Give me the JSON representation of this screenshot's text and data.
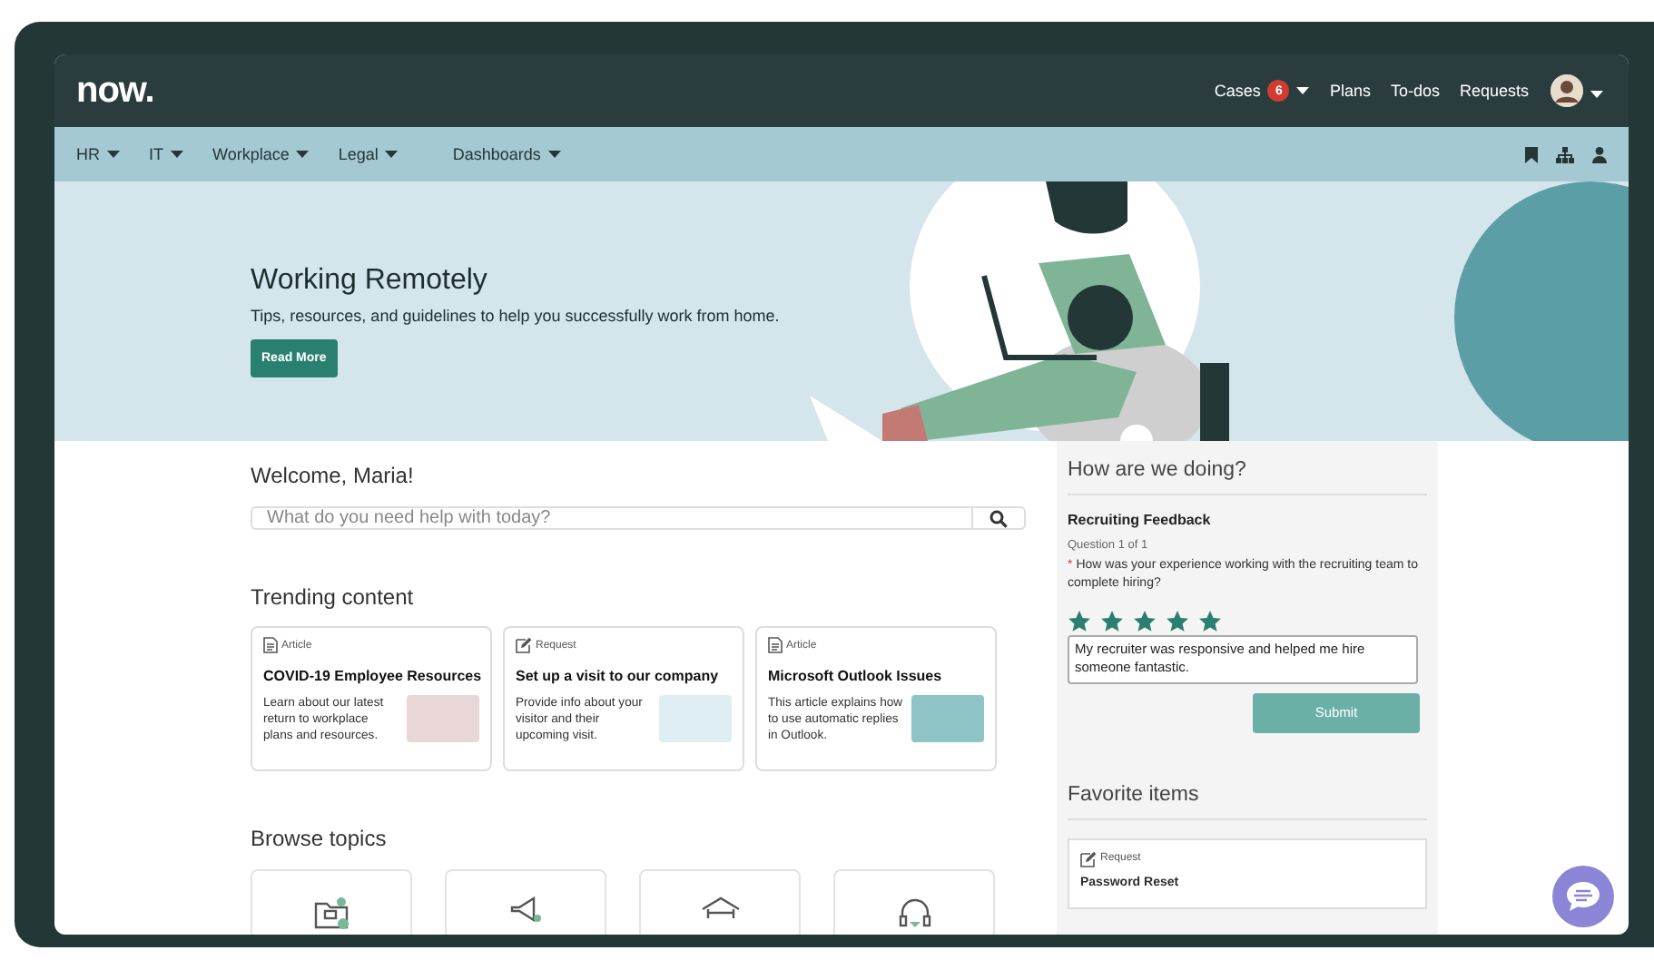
{
  "header": {
    "logo": "now.",
    "links": [
      {
        "label": "Cases",
        "badge": "6",
        "dropdown": true
      },
      {
        "label": "Plans",
        "dropdown": false
      },
      {
        "label": "To-dos",
        "dropdown": false
      },
      {
        "label": "Requests",
        "dropdown": false
      }
    ]
  },
  "nav": {
    "items": [
      "HR",
      "IT",
      "Workplace",
      "Legal",
      "Dashboards"
    ]
  },
  "hero": {
    "title": "Working Remotely",
    "subtitle": "Tips, resources, and guidelines to help you successfully work from home.",
    "button": "Read More"
  },
  "welcome": "Welcome, Maria!",
  "search": {
    "placeholder": "What do you need help with today?"
  },
  "trending": {
    "title": "Trending content",
    "cards": [
      {
        "kind": "article",
        "type_label": "Article",
        "title": "COVID-19 Employee Resources",
        "description": "Learn about our latest return to workplace plans and resources."
      },
      {
        "kind": "request",
        "type_label": "Request",
        "title": "Set up a visit to our company",
        "description": "Provide info about your visitor and their upcoming visit."
      },
      {
        "kind": "article",
        "type_label": "Article",
        "title": "Microsoft Outlook Issues",
        "description": "This article explains how to use automatic replies in Outlook."
      }
    ]
  },
  "browse_topics": {
    "title": "Browse topics",
    "tiles": [
      {
        "kind": "folder"
      },
      {
        "kind": "megaphone"
      },
      {
        "kind": "building"
      },
      {
        "kind": "headset"
      }
    ]
  },
  "feedback": {
    "title": "How are we doing?",
    "survey": "Recruiting Feedback",
    "progress": "Question 1 of 1",
    "required_mark": "*",
    "question": "How was your experience working with the recruiting team to complete hiring?",
    "stars": 5,
    "answer": "My recruiter was responsive and helped me hire someone fantastic.",
    "submit": "Submit"
  },
  "favorites": {
    "title": "Favorite items",
    "items": [
      {
        "kind": "request",
        "type_label": "Request",
        "title": "Password Reset"
      }
    ]
  }
}
